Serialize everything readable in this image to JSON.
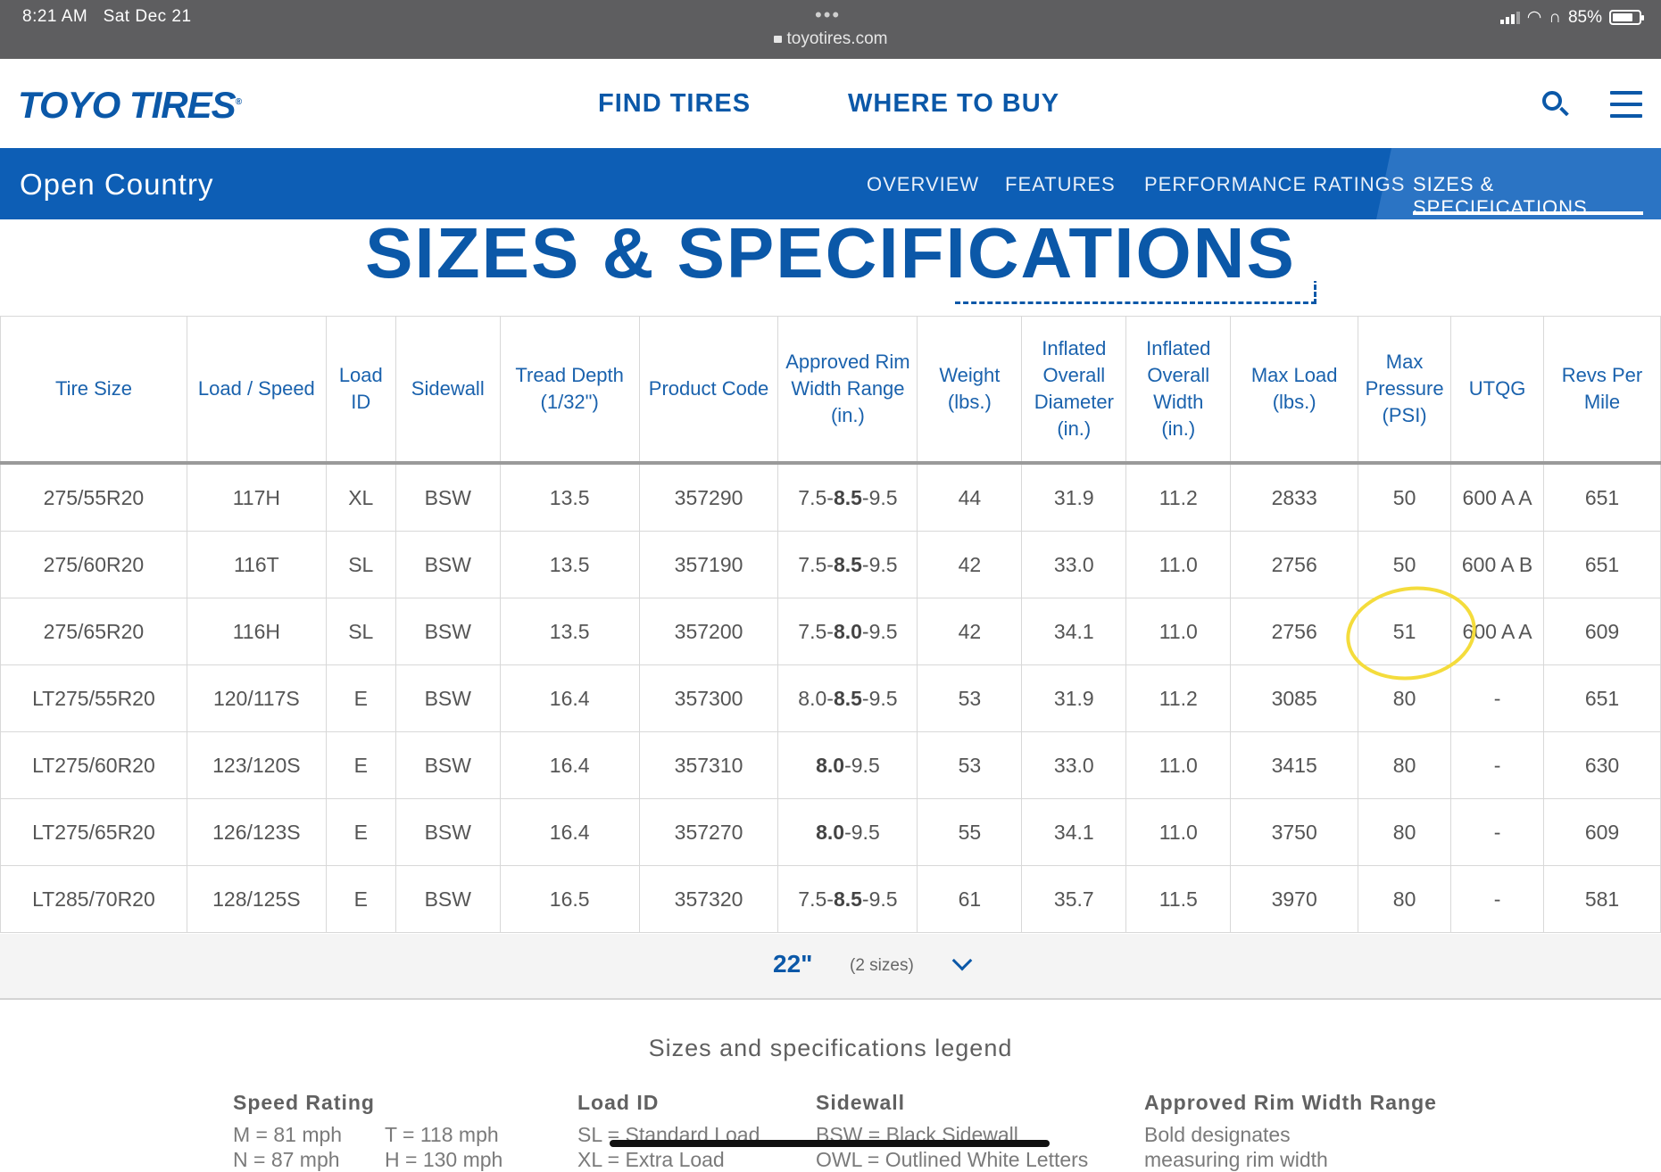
{
  "status_bar": {
    "time": "8:21 AM",
    "date": "Sat Dec 21",
    "url": "toyotires.com",
    "battery": "85%"
  },
  "header": {
    "logo": "TOYO TIRES",
    "nav": [
      "FIND TIRES",
      "WHERE TO BUY"
    ]
  },
  "product_bar": {
    "name": "Open Country",
    "tabs": [
      "OVERVIEW",
      "FEATURES",
      "PERFORMANCE RATINGS",
      "SIZES & SPECIFICATIONS"
    ],
    "active_tab": "SIZES & SPECIFICATIONS"
  },
  "page_title": "SIZES & SPECIFICATIONS",
  "table": {
    "headers": [
      [
        "Tire Size"
      ],
      [
        "Load / Speed"
      ],
      [
        "Load",
        "ID"
      ],
      [
        "Sidewall"
      ],
      [
        "Tread Depth",
        "(1/32\")"
      ],
      [
        "Product Code"
      ],
      [
        "Approved Rim",
        "Width Range",
        "(in.)"
      ],
      [
        "Weight",
        "(lbs.)"
      ],
      [
        "Inflated",
        "Overall",
        "Diameter",
        "(in.)"
      ],
      [
        "Inflated",
        "Overall",
        "Width",
        "(in.)"
      ],
      [
        "Max Load",
        "(lbs.)"
      ],
      [
        "Max",
        "Pressure",
        "(PSI)"
      ],
      [
        "UTQG"
      ],
      [
        "Revs Per",
        "Mile"
      ]
    ],
    "rows": [
      {
        "tire_size": "275/55R20",
        "load_speed": "117H",
        "load_id": "XL",
        "sidewall": "BSW",
        "tread": "13.5",
        "code": "357290",
        "rim_min": "7.5-",
        "rim_bold": "8.5",
        "rim_max": "-9.5",
        "weight": "44",
        "diameter": "31.9",
        "width": "11.2",
        "max_load": "2833",
        "pressure": "50",
        "utqg": "600 A A",
        "revs": "651"
      },
      {
        "tire_size": "275/60R20",
        "load_speed": "116T",
        "load_id": "SL",
        "sidewall": "BSW",
        "tread": "13.5",
        "code": "357190",
        "rim_min": "7.5-",
        "rim_bold": "8.5",
        "rim_max": "-9.5",
        "weight": "42",
        "diameter": "33.0",
        "width": "11.0",
        "max_load": "2756",
        "pressure": "50",
        "utqg": "600 A B",
        "revs": "651"
      },
      {
        "tire_size": "275/65R20",
        "load_speed": "116H",
        "load_id": "SL",
        "sidewall": "BSW",
        "tread": "13.5",
        "code": "357200",
        "rim_min": "7.5-",
        "rim_bold": "8.0",
        "rim_max": "-9.5",
        "weight": "42",
        "diameter": "34.1",
        "width": "11.0",
        "max_load": "2756",
        "pressure": "51",
        "utqg": "600 A A",
        "revs": "609"
      },
      {
        "tire_size": "LT275/55R20",
        "load_speed": "120/117S",
        "load_id": "E",
        "sidewall": "BSW",
        "tread": "16.4",
        "code": "357300",
        "rim_min": "8.0-",
        "rim_bold": "8.5",
        "rim_max": "-9.5",
        "weight": "53",
        "diameter": "31.9",
        "width": "11.2",
        "max_load": "3085",
        "pressure": "80",
        "utqg": "-",
        "revs": "651"
      },
      {
        "tire_size": "LT275/60R20",
        "load_speed": "123/120S",
        "load_id": "E",
        "sidewall": "BSW",
        "tread": "16.4",
        "code": "357310",
        "rim_min": "",
        "rim_bold": "8.0",
        "rim_max": "-9.5",
        "weight": "53",
        "diameter": "33.0",
        "width": "11.0",
        "max_load": "3415",
        "pressure": "80",
        "utqg": "-",
        "revs": "630"
      },
      {
        "tire_size": "LT275/65R20",
        "load_speed": "126/123S",
        "load_id": "E",
        "sidewall": "BSW",
        "tread": "16.4",
        "code": "357270",
        "rim_min": "",
        "rim_bold": "8.0",
        "rim_max": "-9.5",
        "weight": "55",
        "diameter": "34.1",
        "width": "11.0",
        "max_load": "3750",
        "pressure": "80",
        "utqg": "-",
        "revs": "609"
      },
      {
        "tire_size": "LT285/70R20",
        "load_speed": "128/125S",
        "load_id": "E",
        "sidewall": "BSW",
        "tread": "16.5",
        "code": "357320",
        "rim_min": "7.5-",
        "rim_bold": "8.5",
        "rim_max": "-9.5",
        "weight": "61",
        "diameter": "35.7",
        "width": "11.5",
        "max_load": "3970",
        "pressure": "80",
        "utqg": "-",
        "revs": "581"
      }
    ]
  },
  "expander": {
    "size": "22\"",
    "count": "(2 sizes)"
  },
  "legend": {
    "title": "Sizes and specifications legend",
    "speed_rating": {
      "heading": "Speed Rating",
      "lines": [
        "M = 81 mph",
        "T = 118 mph",
        "N = 87 mph",
        "H = 130 mph"
      ]
    },
    "load_id": {
      "heading": "Load ID",
      "lines": [
        "SL = Standard Load",
        "XL = Extra Load"
      ]
    },
    "sidewall": {
      "heading": "Sidewall",
      "lines": [
        "BSW = Black Sidewall",
        "OWL = Outlined White Letters"
      ]
    },
    "rim": {
      "heading": "Approved Rim Width Range",
      "lines": [
        "Bold designates",
        "measuring rim width"
      ]
    }
  },
  "colors": {
    "brand_blue": "#0b58a8",
    "product_bar": "#0d5eb5",
    "highlight": "#f4dc3c"
  }
}
